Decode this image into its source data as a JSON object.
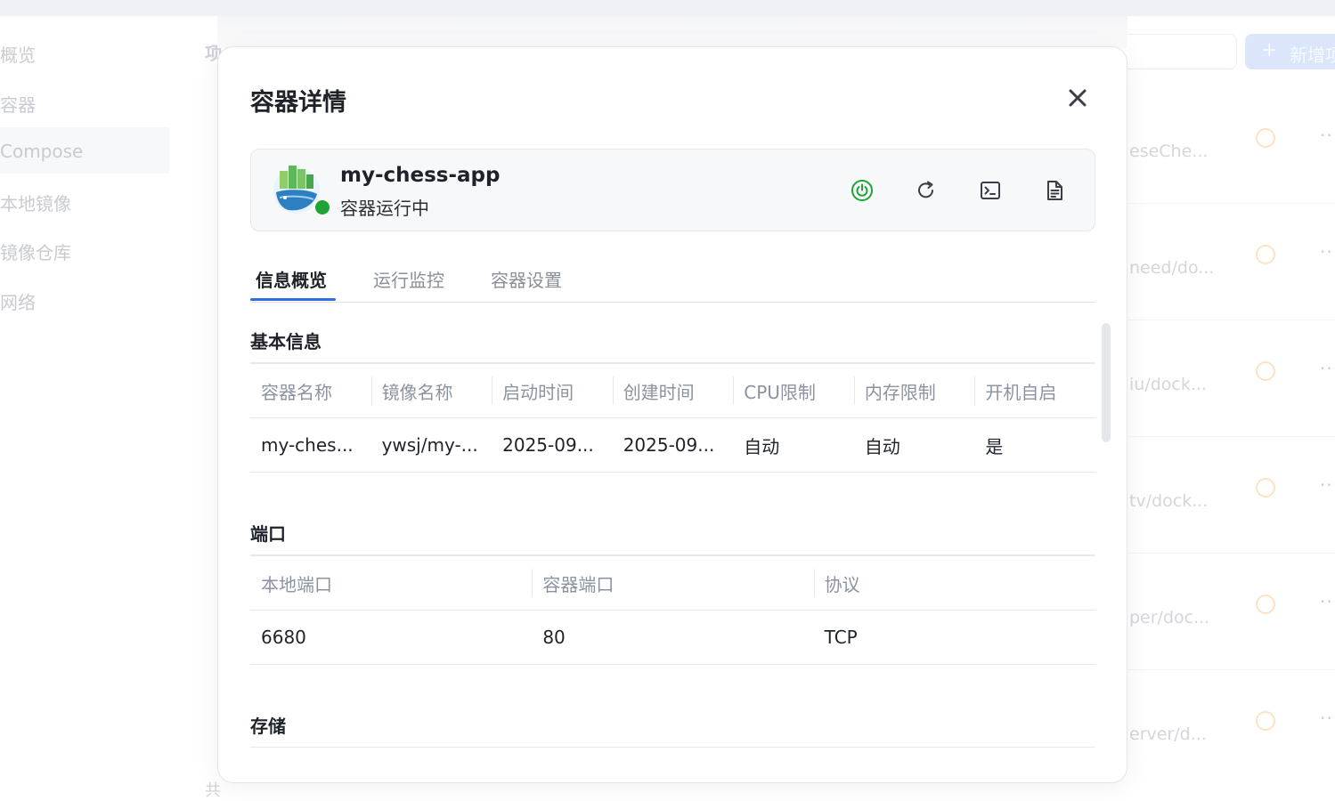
{
  "background": {
    "sidebar": [
      "概览",
      "容器",
      "Compose",
      "本地镜像",
      "镜像仓库",
      "网络"
    ],
    "page_title": "项",
    "page_title_bottom": "共",
    "new_button": "新增项",
    "rows": [
      "eseChe...",
      "need/do...",
      "iu/dock...",
      "tv/dock...",
      "per/doc...",
      "erver/d..."
    ]
  },
  "modal": {
    "title": "容器详情",
    "container": {
      "name": "my-chess-app",
      "status": "容器运行中",
      "status_color": "#1fa334"
    },
    "actions": [
      "power-icon",
      "restart-icon",
      "terminal-icon",
      "log-file-icon"
    ],
    "tabs": [
      "信息概览",
      "运行监控",
      "容器设置"
    ],
    "active_tab": 0,
    "basic_info": {
      "title": "基本信息",
      "headers": [
        "容器名称",
        "镜像名称",
        "启动时间",
        "创建时间",
        "CPU限制",
        "内存限制",
        "开机自启"
      ],
      "row": [
        "my-ches...",
        "ywsj/my-...",
        "2025-09...",
        "2025-09...",
        "自动",
        "自动",
        "是"
      ]
    },
    "ports": {
      "title": "端口",
      "headers": [
        "本地端口",
        "容器端口",
        "协议"
      ],
      "rows": [
        [
          "6680",
          "80",
          "TCP"
        ]
      ]
    },
    "storage": {
      "title": "存储"
    }
  }
}
